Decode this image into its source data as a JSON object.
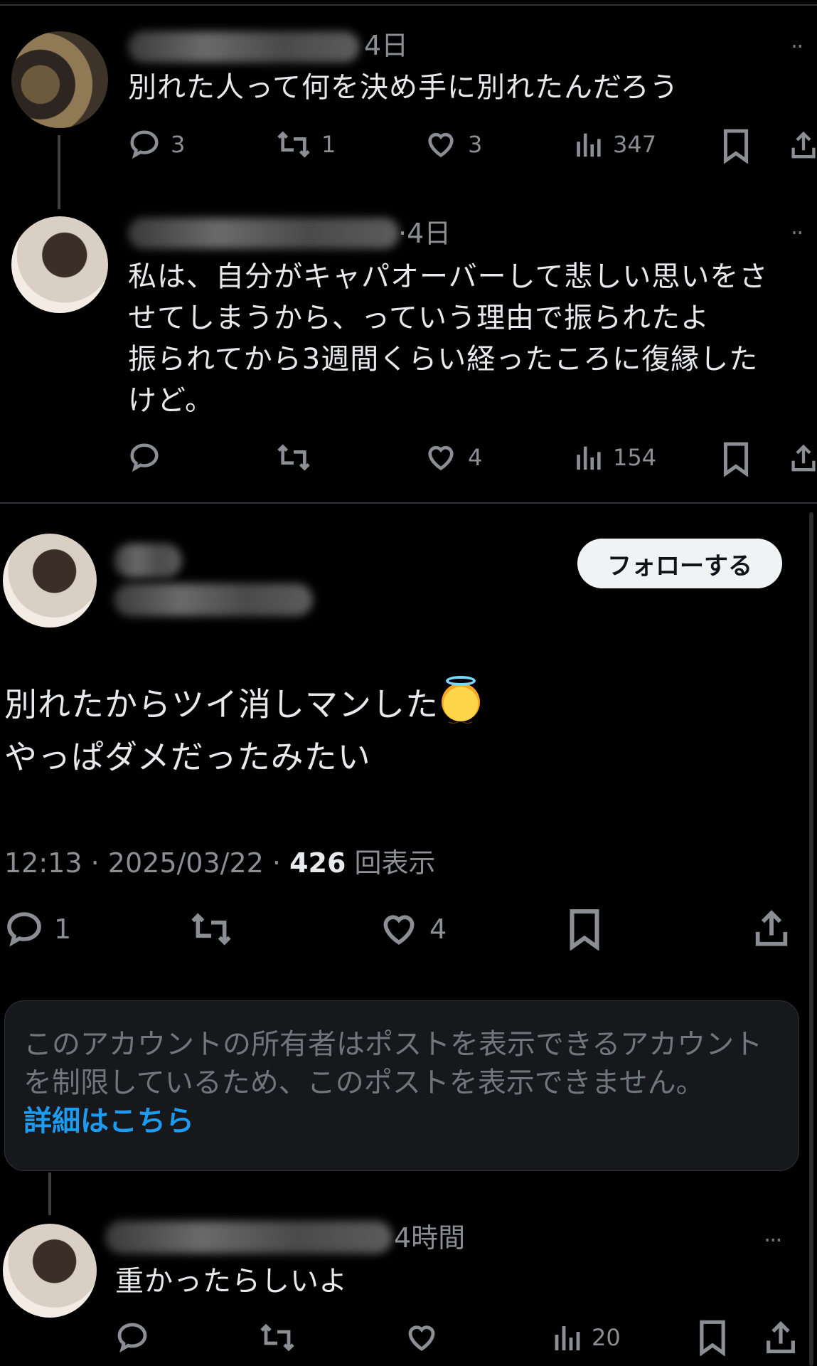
{
  "reply1": {
    "time": "4日",
    "text": "別れた人って何を決め手に別れたんだろう",
    "replies": "3",
    "reposts": "1",
    "likes": "3",
    "views": "347"
  },
  "reply2": {
    "time": "4日",
    "lines": [
      "私は、自分がキャパオーバーして悲しい思いをさ",
      "せてしまうから、っていう理由で振られたよ",
      "振られてから3週間くらい経ったころに復縁した",
      "けど。"
    ],
    "likes": "4",
    "views": "154"
  },
  "main_post": {
    "follow_label": "フォローする",
    "line1": "別れたからツイ消しマンした",
    "line2": "やっぱダメだったみたい",
    "time": "12:13",
    "date": "2025/03/22",
    "views": "426",
    "views_label": "回表示",
    "replies": "1",
    "likes": "4"
  },
  "notice": {
    "text": "このアカウントの所有者はポストを表示できるアカウントを制限しているため、このポストを表示できません。",
    "link": "詳細はこちら"
  },
  "reply3": {
    "time": "4時間",
    "text": "重かったらしいよ",
    "views": "20"
  },
  "icons": [
    "reply-icon",
    "repost-icon",
    "like-icon",
    "views-icon",
    "bookmark-icon",
    "share-icon",
    "more-icon"
  ],
  "colors": {
    "background": "#000000",
    "text": "#e7e9ea",
    "muted": "#8b8f94",
    "link": "#1d9bf0"
  }
}
